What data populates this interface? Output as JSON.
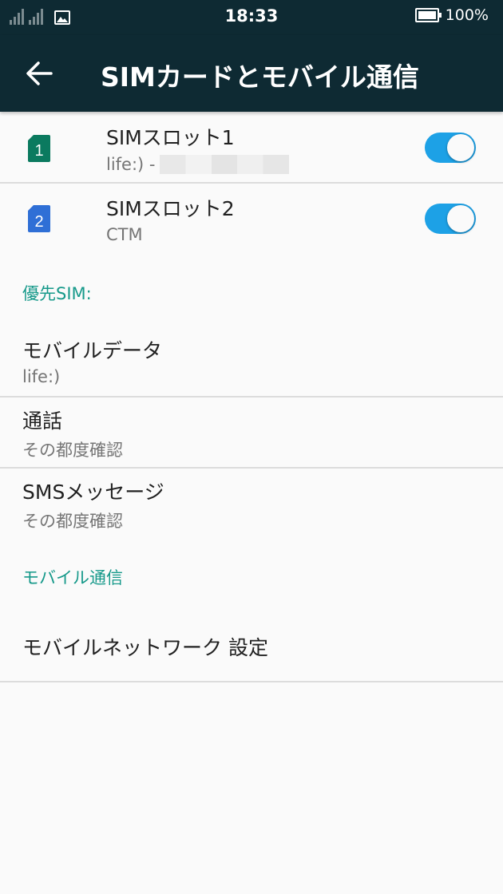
{
  "status_bar": {
    "time": "18:33",
    "battery_percent": "100%",
    "icons": [
      "signal-icon-1",
      "signal-icon-2",
      "image-notification-icon",
      "battery-icon"
    ]
  },
  "app_bar": {
    "title": "SIMカードとモバイル通信",
    "back_icon": "back-arrow-icon",
    "background": "#0e2a33"
  },
  "sim_slots": [
    {
      "title": "SIMスロット1",
      "subtitle": "life:) -",
      "badge_number": "1",
      "badge_color": "#0b7a5f",
      "enabled": true
    },
    {
      "title": "SIMスロット2",
      "subtitle": "CTM",
      "badge_number": "2",
      "badge_color": "#2f6fd6",
      "enabled": true
    }
  ],
  "preferred_sim": {
    "header": "優先SIM:",
    "items": [
      {
        "title": "モバイルデータ",
        "value": "life:)"
      },
      {
        "title": "通話",
        "value": "その都度確認"
      },
      {
        "title": "SMSメッセージ",
        "value": "その都度確認"
      }
    ]
  },
  "mobile": {
    "header": "モバイル通信",
    "items": [
      {
        "title": "モバイルネットワーク 設定"
      }
    ]
  },
  "colors": {
    "accent": "#16998a",
    "toggle_on": "#1da1e6"
  }
}
